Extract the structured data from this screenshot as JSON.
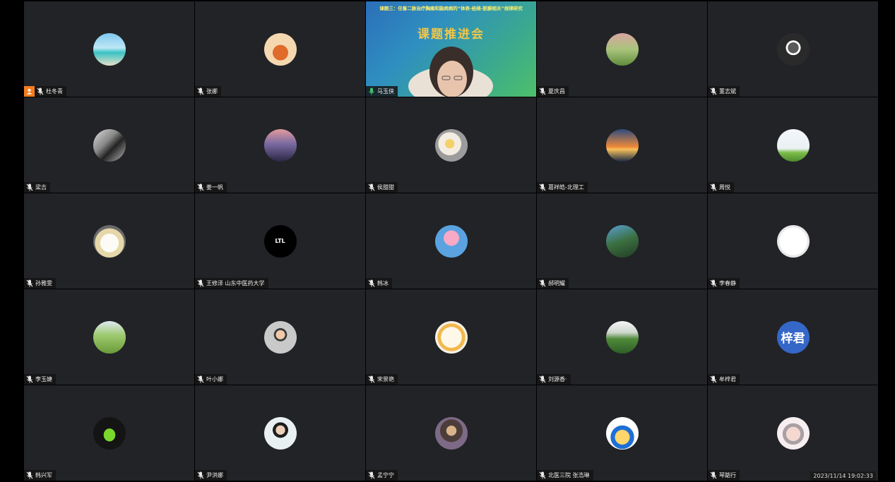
{
  "meeting": {
    "shared_video": {
      "title": "课题三：任督二脉治疗胸痛和脑病病的“体表-经络-脏腑相关”规律研究",
      "banner": "课题推进会"
    },
    "timestamp": "2023/11/14 19:02:33",
    "participants": [
      {
        "name": "杜冬青",
        "avatar": "beach-photo",
        "host": true
      },
      {
        "name": "张娜",
        "avatar": "tiger-cartoon"
      },
      {
        "name": "马玉侠",
        "avatar": "video",
        "speaking": true
      },
      {
        "name": "夏庆昌",
        "avatar": "field-photo"
      },
      {
        "name": "董志斌",
        "avatar": "person-dark-photo"
      },
      {
        "name": "梁吉",
        "avatar": "bw-photo"
      },
      {
        "name": "姜一帆",
        "avatar": "sunset-girl-photo"
      },
      {
        "name": "侯甜甜",
        "avatar": "food-photo"
      },
      {
        "name": "葛祥皓-北理工",
        "avatar": "windmill-sunset-photo"
      },
      {
        "name": "周悦",
        "avatar": "dandelion-photo"
      },
      {
        "name": "孙雅雯",
        "avatar": "cartoon-bear"
      },
      {
        "name": "王修泽 山东中医药大学",
        "avatar": "ltl-logo",
        "avatar_text": "LTL"
      },
      {
        "name": "韩冰",
        "avatar": "peppa-cartoon"
      },
      {
        "name": "郝明耀",
        "avatar": "mountain-photo"
      },
      {
        "name": "李春静",
        "avatar": "cartoon-sketch"
      },
      {
        "name": "李玉婕",
        "avatar": "meadow-photo"
      },
      {
        "name": "叶小娜",
        "avatar": "man-portrait-photo"
      },
      {
        "name": "宋景艳",
        "avatar": "cartoon-boy"
      },
      {
        "name": "刘源香·",
        "avatar": "lake-photo"
      },
      {
        "name": "牟梓君",
        "avatar": "text-avatar",
        "avatar_text": "梓君"
      },
      {
        "name": "韩兴军",
        "avatar": "sports-car-photo"
      },
      {
        "name": "尹洪娜",
        "avatar": "woman-portrait-photo"
      },
      {
        "name": "孟宁宁",
        "avatar": "painting-portrait"
      },
      {
        "name": "北医三院 张浩琳",
        "avatar": "cartoon-hat"
      },
      {
        "name": "琴踮行",
        "avatar": "girl-cartoon"
      }
    ]
  },
  "colors": {
    "tile_bg": "#222327",
    "host_badge": "#f57d1f",
    "speaking_mic": "#3fc46a",
    "text_avatar_bg": "#3567c9"
  }
}
